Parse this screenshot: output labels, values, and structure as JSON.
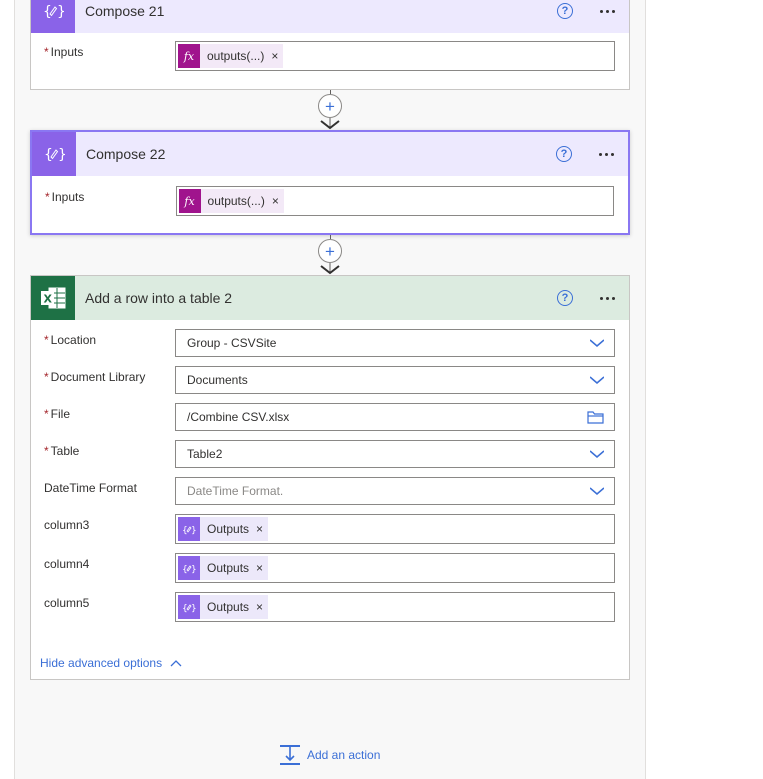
{
  "compose21": {
    "title": "Compose 21",
    "inputs_label": "Inputs",
    "token_text": "outputs(...)"
  },
  "compose22": {
    "title": "Compose 22",
    "inputs_label": "Inputs",
    "token_text": "outputs(...)"
  },
  "excel": {
    "title": "Add a row into a table 2",
    "fields": [
      {
        "label": "Location",
        "value": "Group - CSVSite"
      },
      {
        "label": "Document Library",
        "value": "Documents"
      },
      {
        "label": "File",
        "value": "/Combine CSV.xlsx"
      },
      {
        "label": "Table",
        "value": "Table2"
      },
      {
        "label": "DateTime Format",
        "placeholder": "DateTime Format."
      },
      {
        "label": "column3",
        "token": "Outputs"
      },
      {
        "label": "column4",
        "token": "Outputs"
      },
      {
        "label": "column5",
        "token": "Outputs"
      }
    ],
    "advanced_link": "Hide advanced options"
  },
  "add_action_label": "Add an action",
  "common": {
    "help_glyph": "?",
    "required_mark": "*",
    "fx_glyph": "fx",
    "token_close": "×",
    "plus_glyph": "+"
  },
  "colors": {
    "compose_header": "#ede9fe",
    "compose_icon": "#8a63e8",
    "excel_header": "#dcebe0",
    "excel_icon": "#1e7145",
    "link": "#3b6fd6",
    "fx_token": "#a0148d"
  }
}
